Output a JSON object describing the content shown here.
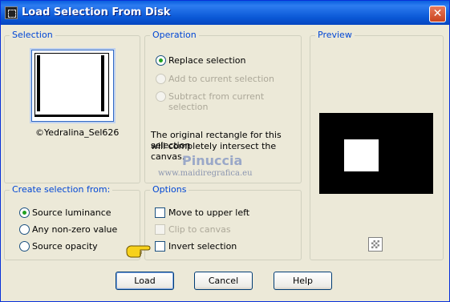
{
  "window": {
    "title": "Load Selection From Disk",
    "close_glyph": "✕"
  },
  "selection": {
    "legend": "Selection",
    "filename": "©Yedralina_Sel626"
  },
  "operation": {
    "legend": "Operation",
    "options": [
      {
        "label": "Replace selection",
        "checked": true,
        "enabled": true
      },
      {
        "label": "Add to current selection",
        "checked": false,
        "enabled": false
      },
      {
        "label": "Subtract from current selection",
        "checked": false,
        "enabled": false
      }
    ],
    "info_line1": "The original rectangle for this selection",
    "info_line2": "will completely intersect the canvas."
  },
  "watermark": {
    "name": "Pinuccia",
    "url": "www.maidiregrafica.eu"
  },
  "preview": {
    "legend": "Preview"
  },
  "create_from": {
    "legend": "Create selection from:",
    "options": [
      {
        "label": "Source luminance",
        "checked": true
      },
      {
        "label": "Any non-zero value",
        "checked": false
      },
      {
        "label": "Source opacity",
        "checked": false
      }
    ]
  },
  "options": {
    "legend": "Options",
    "items": [
      {
        "label": "Move to upper left",
        "enabled": true
      },
      {
        "label": "Clip to canvas",
        "enabled": false
      },
      {
        "label": "Invert selection",
        "enabled": true
      }
    ]
  },
  "buttons": {
    "load": "Load",
    "cancel": "Cancel",
    "help": "Help"
  }
}
